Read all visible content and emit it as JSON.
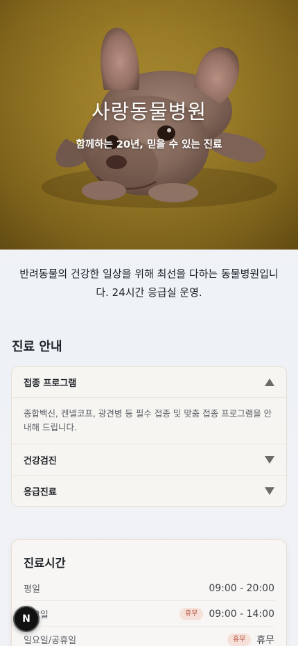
{
  "hero": {
    "title": "사랑동물병원",
    "subtitle": "함께하는 20년, 믿을 수 있는 진료"
  },
  "intro": "반려동물의 건강한 일상을 위해 최선을 다하는 동물병원입니다. 24시간 응급실 운영.",
  "services": {
    "heading": "진료 안내",
    "items": [
      {
        "label": "접종 프로그램",
        "expanded": true,
        "body": "종합백신, 켄넬코프, 광견병 등 필수 접종 및 맞춤 접종 프로그램을 안내해 드립니다."
      },
      {
        "label": "건강검진",
        "expanded": false
      },
      {
        "label": "응급진료",
        "expanded": false
      }
    ]
  },
  "hours": {
    "title": "진료시간",
    "rows": [
      {
        "day": "평일",
        "time": "09:00 - 20:00",
        "badge": ""
      },
      {
        "day": "토요일",
        "time": "09:00 - 14:00",
        "badge": "휴무"
      },
      {
        "day": "일요일/공휴일",
        "time": "휴무",
        "badge": "휴무"
      }
    ]
  },
  "floating_button": {
    "label": "N"
  },
  "colors": {
    "hero_bg": "#a4842a",
    "badge_bg": "#f6e1da",
    "badge_text": "#b14a35"
  }
}
